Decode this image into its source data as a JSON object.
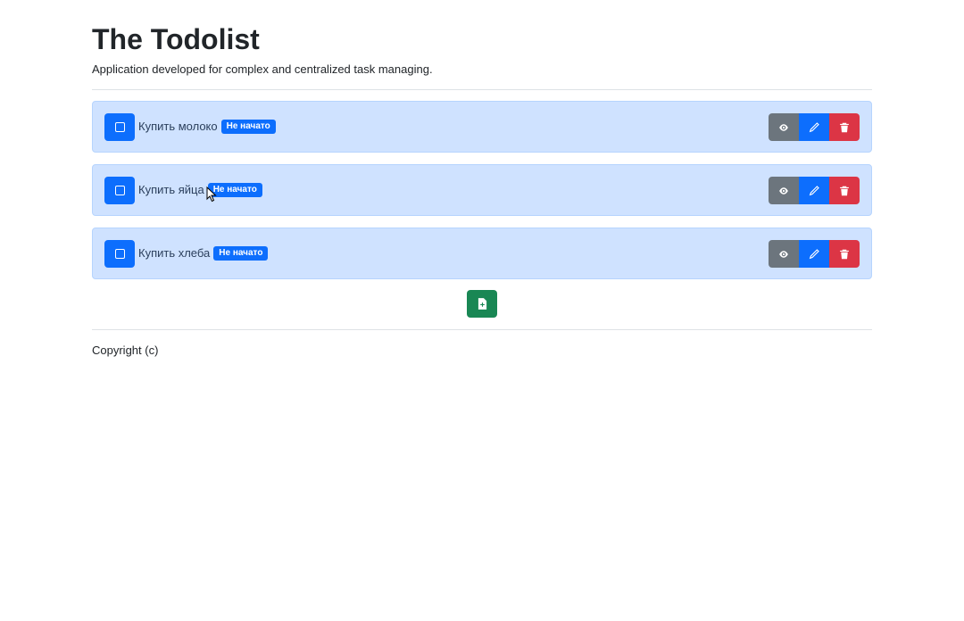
{
  "header": {
    "title": "The Todolist",
    "subtitle": "Application developed for complex and centralized task managing."
  },
  "tasks": [
    {
      "title": "Купить молоко",
      "status": "Не начато"
    },
    {
      "title": "Купить яйца",
      "status": "Не начато"
    },
    {
      "title": "Купить хлеба",
      "status": "Не начато"
    }
  ],
  "icons": {
    "checkbox": "square-icon",
    "view": "eye-icon",
    "edit": "pencil-icon",
    "delete": "trash-icon",
    "add": "file-plus-icon"
  },
  "colors": {
    "primary": "#0d6efd",
    "secondary": "#6c757d",
    "danger": "#dc3545",
    "success": "#198754",
    "task_bg": "#cfe2ff"
  },
  "footer": {
    "copyright": "Copyright (c)"
  }
}
